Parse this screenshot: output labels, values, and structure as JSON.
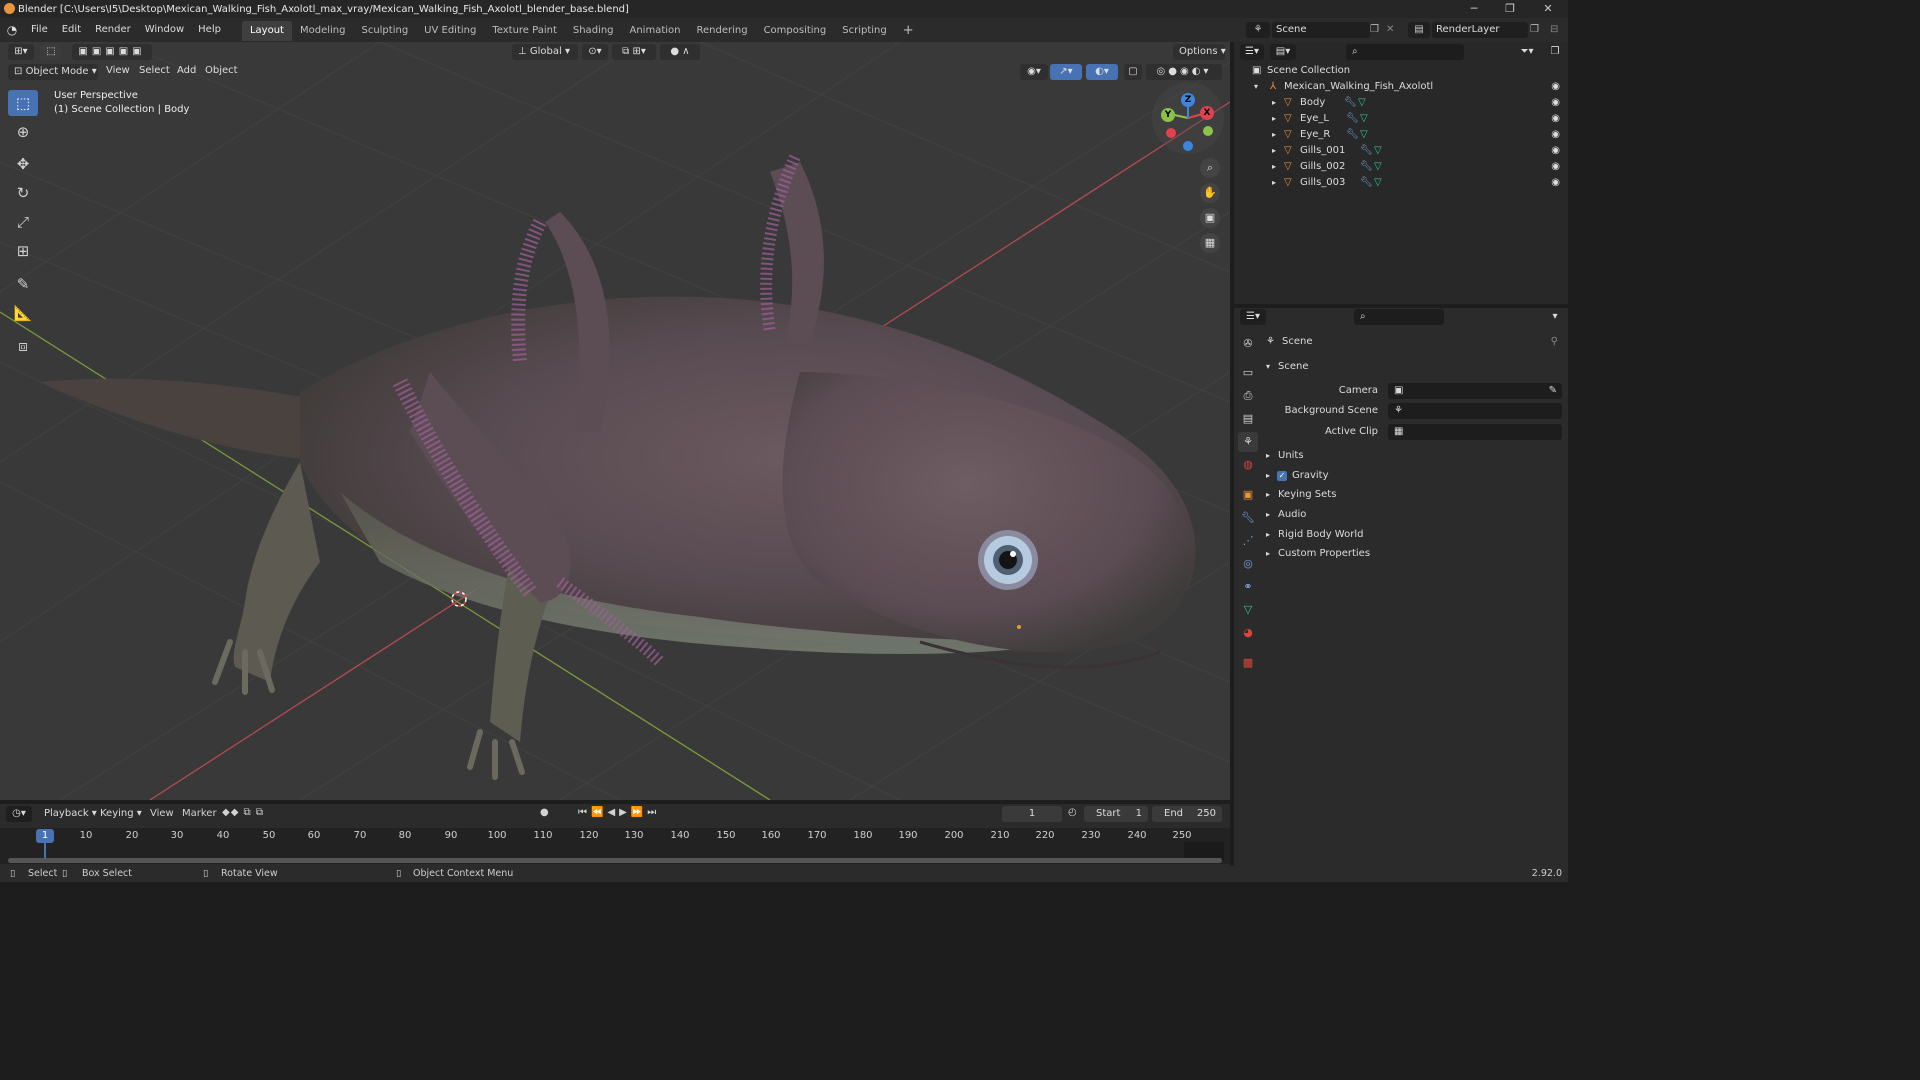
{
  "window": {
    "title": "Blender [C:\\Users\\I5\\Desktop\\Mexican_Walking_Fish_Axolotl_max_vray/Mexican_Walking_Fish_Axolotl_blender_base.blend]",
    "minimize": "─",
    "maximize": "❐",
    "close": "✕"
  },
  "menu": [
    "File",
    "Edit",
    "Render",
    "Window",
    "Help"
  ],
  "workspaces": [
    "Layout",
    "Modeling",
    "Sculpting",
    "UV Editing",
    "Texture Paint",
    "Shading",
    "Animation",
    "Rendering",
    "Compositing",
    "Scripting"
  ],
  "add_workspace": "+",
  "scene_selector": {
    "scene": "Scene",
    "view_layer": "RenderLayer"
  },
  "viewport_header": {
    "mode": "Object Mode",
    "menus": [
      "View",
      "Select",
      "Add",
      "Object"
    ],
    "orientation": "Global",
    "options": "Options"
  },
  "viewport": {
    "perspective_label": "User Perspective",
    "collection_label": "(1) Scene Collection | Body",
    "gizmo": {
      "x": "X",
      "y": "Y",
      "z": "Z"
    }
  },
  "outliner": {
    "root": "Scene Collection",
    "collection": "Mexican_Walking_Fish_Axolotl",
    "objects": [
      "Body",
      "Eye_L",
      "Eye_R",
      "Gills_001",
      "Gills_002",
      "Gills_003"
    ]
  },
  "properties": {
    "context_title": "Scene",
    "panel": "Scene",
    "fields": [
      {
        "label": "Camera"
      },
      {
        "label": "Background Scene"
      },
      {
        "label": "Active Clip"
      }
    ],
    "subpanels": [
      "Units",
      "Gravity",
      "Keying Sets",
      "Audio",
      "Rigid Body World",
      "Custom Properties"
    ]
  },
  "timeline": {
    "menus": [
      "Playback",
      "Keying",
      "View",
      "Marker"
    ],
    "current_frame": "1",
    "start_label": "Start",
    "start": "1",
    "end_label": "End",
    "end": "250",
    "ticks": [
      "1",
      "10",
      "20",
      "30",
      "40",
      "50",
      "60",
      "70",
      "80",
      "90",
      "100",
      "110",
      "120",
      "130",
      "140",
      "150",
      "160",
      "170",
      "180",
      "190",
      "200",
      "210",
      "220",
      "230",
      "240",
      "250"
    ]
  },
  "statusbar": {
    "select": "Select",
    "box_select": "Box Select",
    "rotate": "Rotate View",
    "context_menu": "Object Context Menu",
    "version": "2.92.0"
  },
  "colors": {
    "accent": "#4772b3",
    "x_axis": "#e0434f",
    "y_axis": "#8bc34a",
    "z_axis": "#3c86e0",
    "object_orange": "#e8953c",
    "mesh_green": "#29c994"
  }
}
